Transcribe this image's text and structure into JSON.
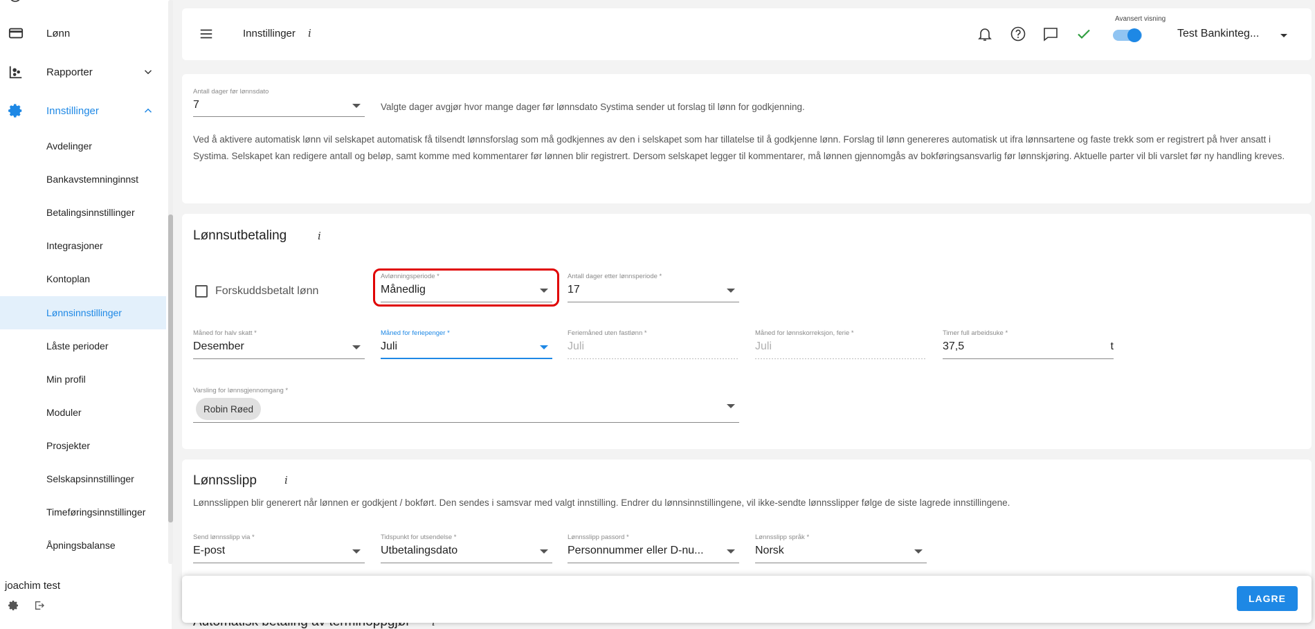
{
  "sidebar": {
    "items": [
      {
        "label": "Lønn",
        "icon": "credit-card-icon"
      },
      {
        "label": "Rapporter",
        "icon": "reports-icon"
      },
      {
        "label": "Innstillinger",
        "icon": "gear-icon"
      }
    ],
    "sub_items": [
      "Avdelinger",
      "Bankavstemninginnst",
      "Betalingsinnstillinger",
      "Integrasjoner",
      "Kontoplan",
      "Lønnsinnstillinger",
      "Låste perioder",
      "Min profil",
      "Moduler",
      "Prosjekter",
      "Selskapsinnstillinger",
      "Timeføringsinnstillinger",
      "Åpningsbalanse"
    ],
    "selected": "Lønnsinnstillinger",
    "user": "joachim test"
  },
  "header": {
    "title": "Innstillinger",
    "info": "i",
    "advanced_label": "Avansert visning",
    "company": "Test Bankinteg..."
  },
  "auto_salary": {
    "days_label": "Antall dager før lønnsdato",
    "days_value": "7",
    "days_hint": "Valgte dager avgjør hvor mange dager før lønnsdato Systima sender ut forslag til lønn for godkjenning.",
    "description": "Ved å aktivere automatisk lønn vil selskapet automatisk få tilsendt lønnsforslag som må godkjennes av den i selskapet som har tillatelse til å godkjenne lønn. Forslag til lønn genereres automatisk ut ifra lønnsartene og faste trekk som er registrert på hver ansatt i Systima. Selskapet kan redigere antall og beløp, samt komme med kommentarer før lønnen blir registrert. Dersom selskapet legger til kommentarer, må lønnen gjennomgås av bokføringsansvarlig før lønnskjøring. Aktuelle parter vil bli varslet før ny handling kreves."
  },
  "payout": {
    "title": "Lønnsutbetaling",
    "info": "i",
    "advance_label": "Forskuddsbetalt lønn",
    "period_label": "Avlønningsperiode *",
    "period_value": "Månedlig",
    "days_after_label": "Antall dager etter lønnsperiode *",
    "days_after_value": "17",
    "half_tax_label": "Måned for halv skatt *",
    "half_tax_value": "Desember",
    "holiday_pay_label": "Måned for feriepenger *",
    "holiday_pay_value": "Juli",
    "holiday_month_label": "Feriemåned uten fastlønn *",
    "holiday_month_value": "Juli",
    "correction_label": "Måned for lønnskorreksjon, ferie *",
    "correction_value": "Juli",
    "hours_label": "Timer full arbeidsuke *",
    "hours_value": "37,5",
    "hours_unit": "t",
    "notify_label": "Varsling for lønnsgjennomgang *",
    "notify_chip": "Robin Røed"
  },
  "payslip": {
    "title": "Lønnsslipp",
    "info": "i",
    "description": "Lønnsslippen blir generert når lønnen er godkjent / bokført. Den sendes i samsvar med valgt innstilling. Endrer du lønnsinnstillingene, vil ikke-sendte lønnsslipper følge de siste lagrede innstillingene.",
    "send_label": "Send lønnsslipp via *",
    "send_value": "E-post",
    "time_label": "Tidspunkt for utsendelse *",
    "time_value": "Utbetalingsdato",
    "password_label": "Lønnsslipp passord *",
    "password_value": "Personnummer eller D-nu...",
    "lang_label": "Lønnsslipp språk *",
    "lang_value": "Norsk"
  },
  "next_section": {
    "title": "Automatisk betaling av terminoppgjør",
    "info": "i"
  },
  "savebar": {
    "save_label": "LAGRE"
  },
  "colors": {
    "accent": "#1e88e5",
    "selected_bg": "#e3f0fb",
    "highlight": "#e00000",
    "success": "#2e9d3e"
  }
}
